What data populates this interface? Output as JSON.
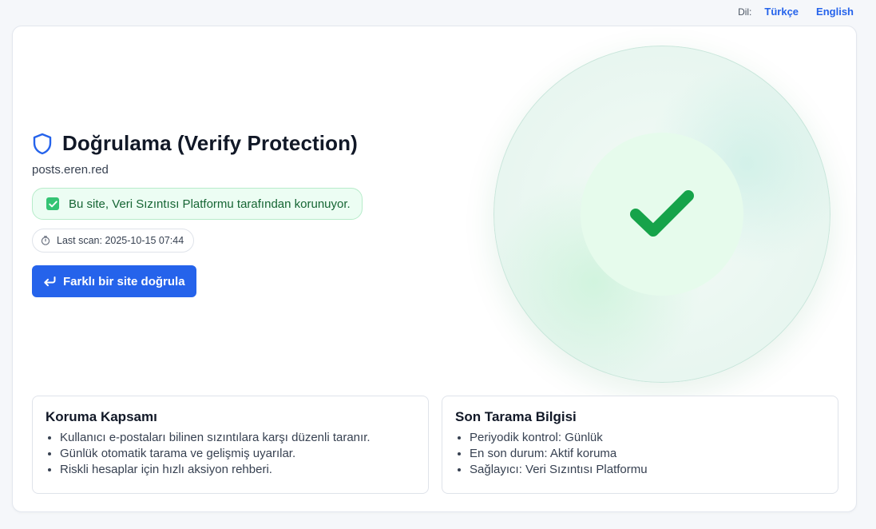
{
  "language": {
    "label": "Dil:",
    "options": [
      "Türkçe",
      "English"
    ]
  },
  "header": {
    "title": "Doğrulama (Verify Protection)",
    "site": "posts.eren.red"
  },
  "status": {
    "message": "Bu site, Veri Sızıntısı Platformu tarafından korunuyor.",
    "last_scan": "Last scan: 2025-10-15 07:44"
  },
  "actions": {
    "verify_other_label": "Farklı bir site doğrula"
  },
  "coverage": {
    "heading": "Koruma Kapsamı",
    "items": [
      "Kullanıcı e-postaları bilinen sızıntılara karşı düzenli taranır.",
      "Günlük otomatik tarama ve gelişmiş uyarılar.",
      "Riskli hesaplar için hızlı aksiyon rehberi."
    ]
  },
  "last_scan_info": {
    "heading": "Son Tarama Bilgisi",
    "items": [
      "Periyodik kontrol: Günlük",
      "En son durum: Aktif koruma",
      "Sağlayıcı: Veri Sızıntısı Platformu"
    ]
  },
  "icons": {
    "title": "shield-icon",
    "status": "check-box-icon",
    "scan": "clock-icon",
    "button": "return-icon",
    "hero": "check-icon"
  },
  "colors": {
    "accent": "#2563eb",
    "success": "#16a34a",
    "success_bg": "#ecfdf3"
  }
}
